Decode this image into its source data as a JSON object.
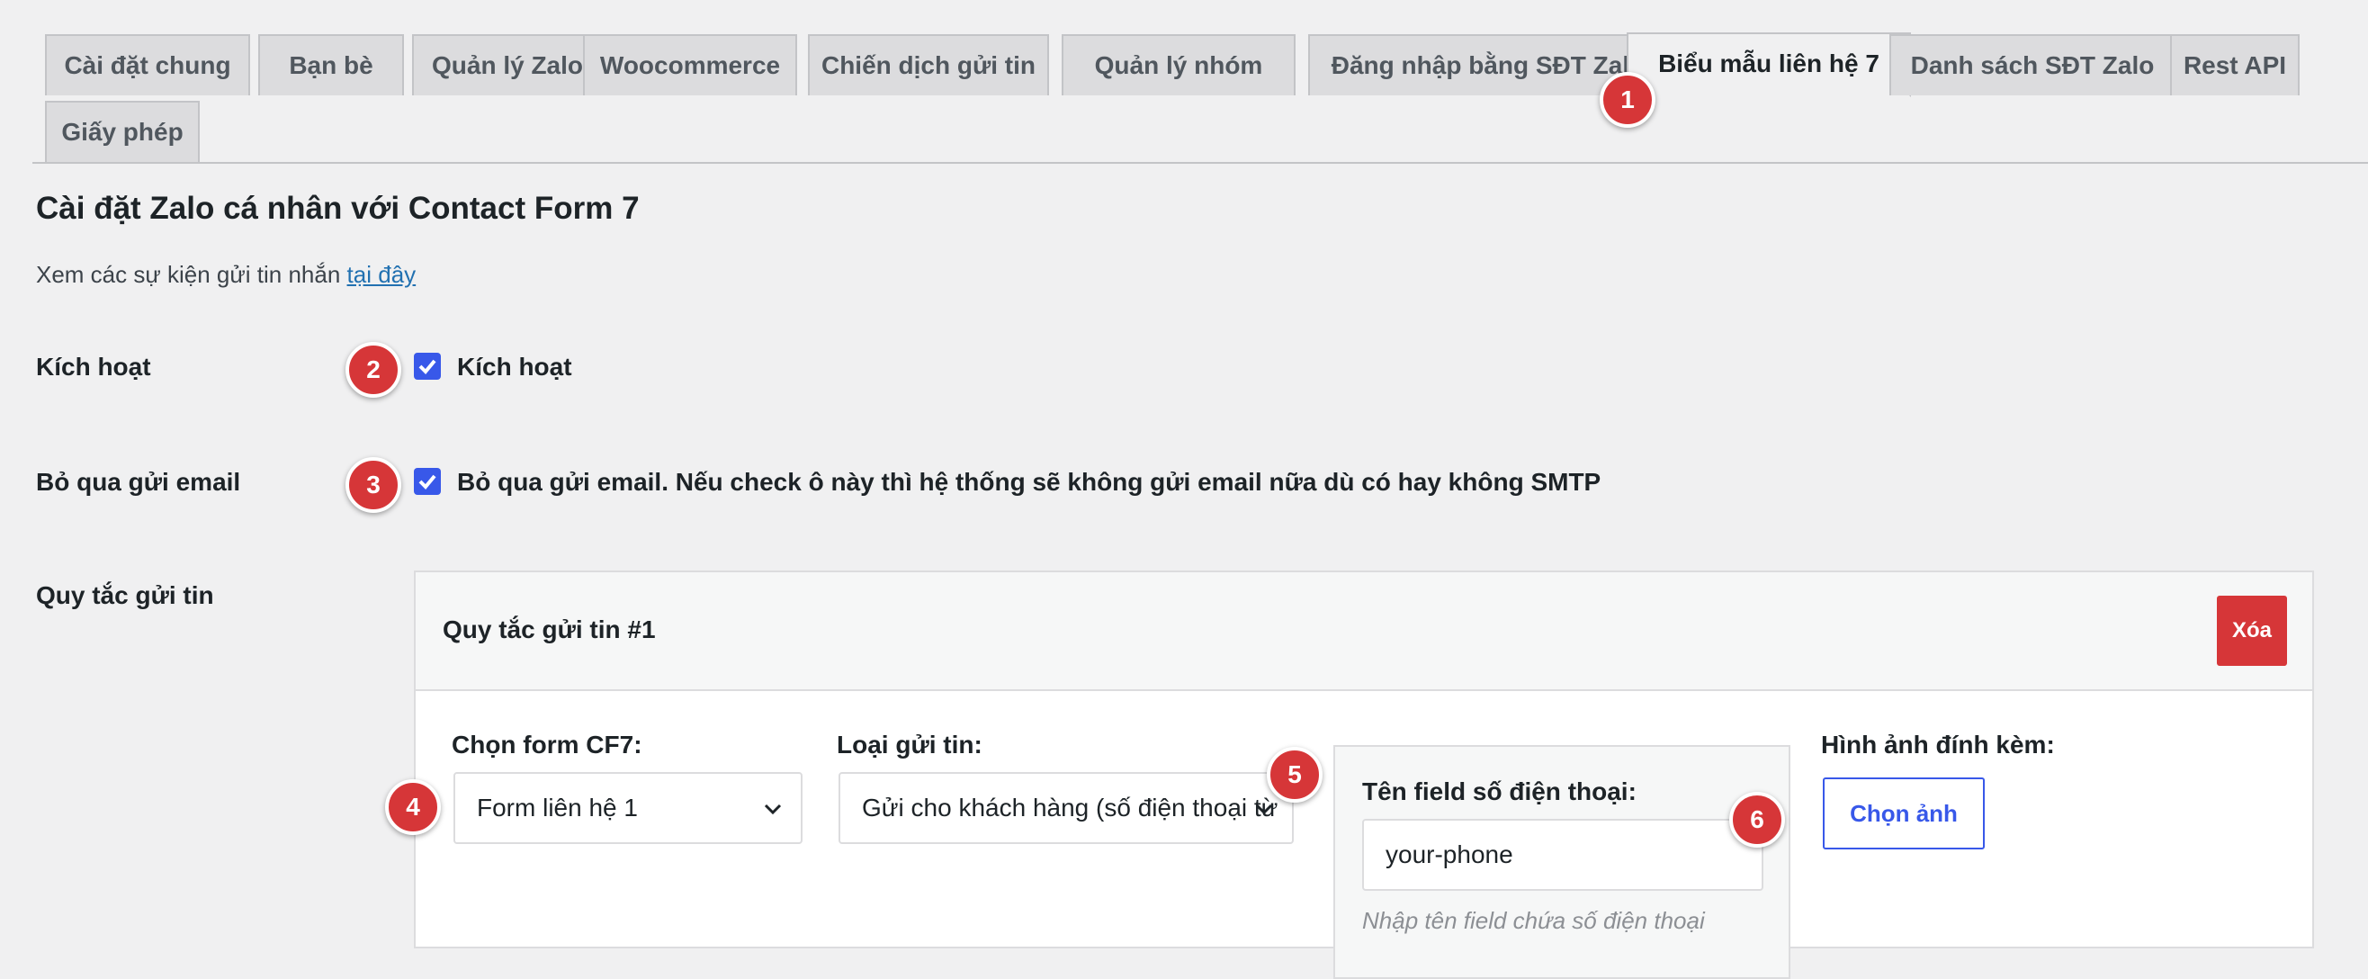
{
  "tabs": [
    {
      "label": "Cài đặt chung"
    },
    {
      "label": "Bạn bè"
    },
    {
      "label": "Quản lý Zalo"
    },
    {
      "label": "Woocommerce"
    },
    {
      "label": "Chiến dịch gửi tin"
    },
    {
      "label": "Quản lý nhóm"
    },
    {
      "label": "Đăng nhập bằng SĐT Zalo"
    },
    {
      "label": "Biểu mẫu liên hệ 7"
    },
    {
      "label": "Danh sách SĐT Zalo"
    },
    {
      "label": "Rest API"
    },
    {
      "label": "Giấy phép"
    }
  ],
  "active_tab": "Biểu mẫu liên hệ 7",
  "page": {
    "title": "Cài đặt Zalo cá nhân với Contact Form 7",
    "description_prefix": "Xem các sự kiện gửi tin nhắn",
    "description_link": "tại đây"
  },
  "settings": {
    "activate_label": "Kích hoạt",
    "activate_checkbox_label": "Kích hoạt",
    "activate_checked": true,
    "skip_email_label": "Bỏ qua gửi email",
    "skip_email_checkbox_label": "Bỏ qua gửi email. Nếu check ô này thì hệ thống sẽ không gửi email nữa dù có hay không SMTP",
    "skip_email_checked": true,
    "rules_label": "Quy tắc gửi tin"
  },
  "rule": {
    "title": "Quy tắc gửi tin #1",
    "delete_label": "Xóa",
    "form_label": "Chọn form CF7:",
    "form_value": "Form liên hệ 1",
    "type_label": "Loại gửi tin:",
    "type_value": "Gửi cho khách hàng (số điện thoại từ",
    "phone_field_label": "Tên field số điện thoại:",
    "phone_field_value": "your-phone",
    "phone_field_hint": "Nhập tên field chứa số điện thoại",
    "attachment_label": "Hình ảnh đính kèm:",
    "choose_image_label": "Chọn ảnh"
  },
  "badges": [
    "1",
    "2",
    "3",
    "4",
    "5",
    "6"
  ],
  "colors": {
    "accent": "#3858e9",
    "danger": "#d63638",
    "link": "#2271b1",
    "background": "#f0f0f1"
  }
}
